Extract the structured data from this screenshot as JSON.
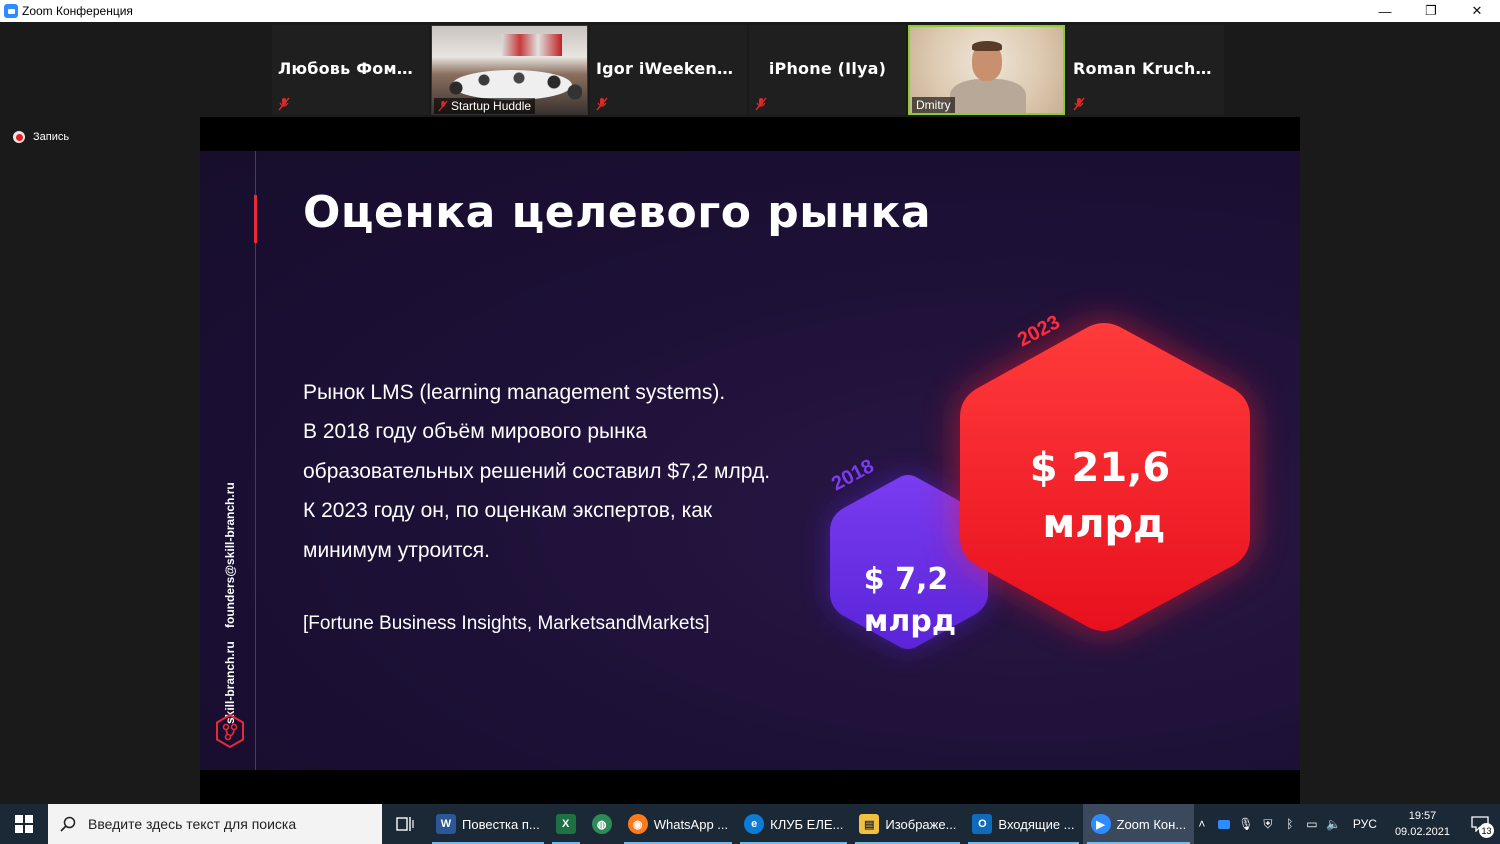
{
  "window": {
    "title": "Zoom Конференция",
    "minimize": "—",
    "restore": "❐",
    "close": "✕"
  },
  "participants": [
    {
      "name": "Любовь Фоми...",
      "type": "name",
      "muted": true
    },
    {
      "name": "Startup Huddle",
      "type": "video",
      "muted": true
    },
    {
      "name": "Igor iWeekender",
      "type": "name",
      "muted": true
    },
    {
      "name": "iPhone (Ilya)",
      "type": "name",
      "muted": true
    },
    {
      "name": "Dmitry",
      "type": "video",
      "muted": false,
      "active_speaker": true
    },
    {
      "name": "Roman  Kruchen...",
      "type": "name",
      "muted": true
    }
  ],
  "recording": {
    "label": "Запись"
  },
  "slide": {
    "title": "Оценка целевого рынка",
    "body": [
      "Рынок LMS (learning management systems).",
      "В 2018 году объём мирового рынка",
      "образовательных решений составил $7,2 млрд.",
      "К 2023 году он, по оценкам экспертов, как",
      "минимум утроится."
    ],
    "source": "[Fortune Business Insights, MarketsandMarkets]",
    "side_email": "founders@skill-branch.ru",
    "side_site": "skill-branch.ru",
    "hex_small": {
      "year": "2018",
      "amount": "$ 7,2",
      "unit": "млрд",
      "color": "#6a33e8"
    },
    "hex_big": {
      "year": "2023",
      "amount": "$ 21,6",
      "unit": "млрд",
      "color": "#ff1f2d"
    }
  },
  "taskbar": {
    "search_placeholder": "Введите здесь текст для поиска",
    "apps": [
      {
        "label": "Повестка п...",
        "icon": "word-icon",
        "color": "#2b5797",
        "glyph": "W"
      },
      {
        "label": "",
        "icon": "excel-icon",
        "color": "#1e7145",
        "glyph": "X"
      },
      {
        "label": "",
        "icon": "maps-icon",
        "color": "#2e8b57",
        "glyph": "◍"
      },
      {
        "label": "WhatsApp ...",
        "icon": "firefox-icon",
        "color": "#ff7a1a",
        "glyph": "◉"
      },
      {
        "label": "КЛУБ ЕЛЕ...",
        "icon": "edge-icon",
        "color": "#0c7cd5",
        "glyph": "e"
      },
      {
        "label": "Изображе...",
        "icon": "photos-icon",
        "color": "#f0c040",
        "glyph": "▤"
      },
      {
        "label": "Входящие ...",
        "icon": "outlook-icon",
        "color": "#0f6cbd",
        "glyph": "O"
      },
      {
        "label": "Zoom Кон...",
        "icon": "zoom-icon",
        "color": "#2d8cff",
        "glyph": "▶"
      }
    ],
    "lang": "РУС",
    "time": "19:57",
    "date": "09.02.2021",
    "notifications": "13"
  }
}
